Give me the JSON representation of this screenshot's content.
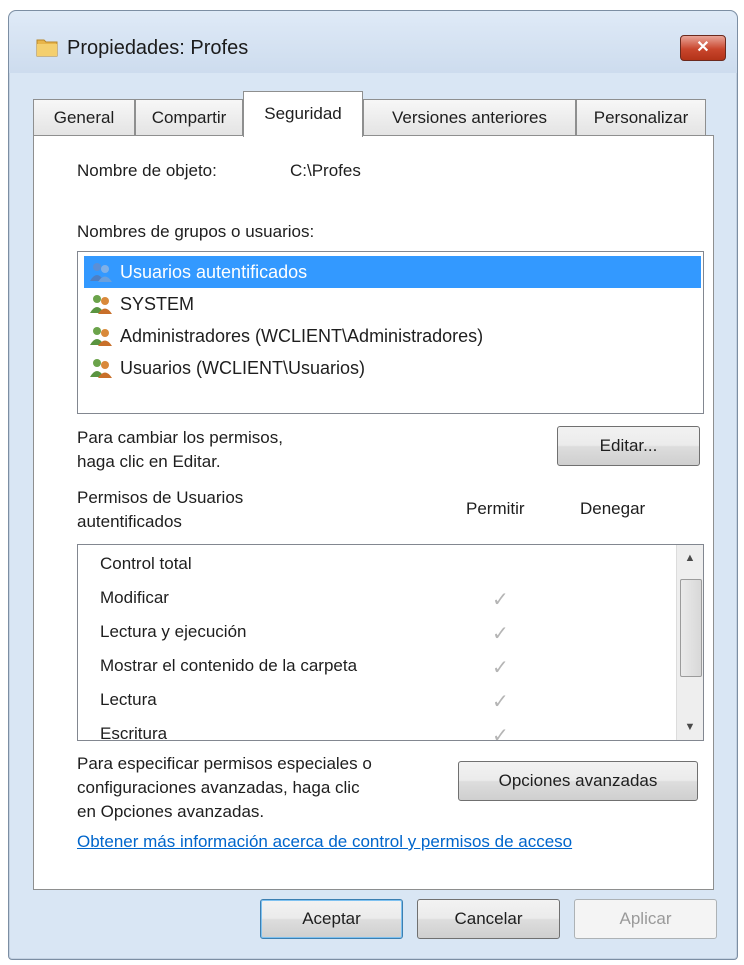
{
  "window": {
    "title": "Propiedades: Profes",
    "close_label": "✕"
  },
  "tabs": [
    {
      "label": "General"
    },
    {
      "label": "Compartir"
    },
    {
      "label": "Seguridad"
    },
    {
      "label": "Versiones anteriores"
    },
    {
      "label": "Personalizar"
    }
  ],
  "security": {
    "object_name_label": "Nombre de objeto:",
    "object_name_value": "C:\\Profes",
    "groups_label": "Nombres de grupos o usuarios:",
    "groups": [
      {
        "name": "Usuarios autentificados",
        "selected": true
      },
      {
        "name": "SYSTEM",
        "selected": false
      },
      {
        "name": "Administradores (WCLIENT\\Administradores)",
        "selected": false
      },
      {
        "name": "Usuarios (WCLIENT\\Usuarios)",
        "selected": false
      }
    ],
    "change_line1": "Para cambiar los permisos,",
    "change_line2": "haga clic en Editar.",
    "edit_button": "Editar...",
    "perm_header_line1": "Permisos de Usuarios",
    "perm_header_line2": "autentificados",
    "allow_header": "Permitir",
    "deny_header": "Denegar",
    "permissions": [
      {
        "name": "Control total",
        "allow": false
      },
      {
        "name": "Modificar",
        "allow": true
      },
      {
        "name": "Lectura y ejecución",
        "allow": true
      },
      {
        "name": "Mostrar el contenido de la carpeta",
        "allow": true
      },
      {
        "name": "Lectura",
        "allow": true
      },
      {
        "name": "Escritura",
        "allow": true
      }
    ],
    "check_glyph": "✓",
    "special_line1": "Para especificar permisos especiales o",
    "special_line2": "configuraciones avanzadas, haga clic",
    "special_line3": "en Opciones avanzadas.",
    "advanced_button": "Opciones avanzadas",
    "info_link": "Obtener más información acerca de control y permisos de acceso"
  },
  "footer": {
    "ok": "Aceptar",
    "cancel": "Cancelar",
    "apply": "Aplicar"
  },
  "colors": {
    "selection": "#3399ff",
    "link": "#0066cc",
    "close_red": "#c9462d"
  }
}
